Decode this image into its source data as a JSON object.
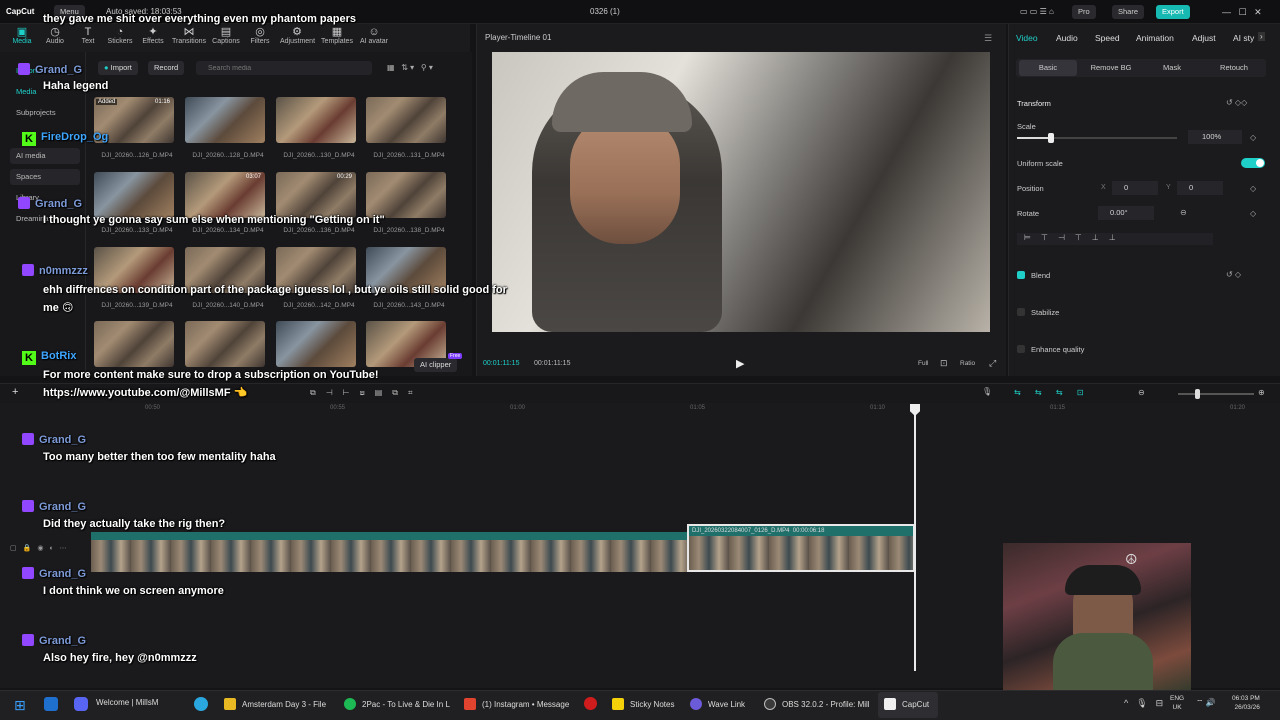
{
  "app": {
    "name": "CapCut",
    "menu": "Menu",
    "autosave": "Auto saved: 18:03:53",
    "project": "0326 (1)",
    "pro": "Pro",
    "share": "Share",
    "export": "Export"
  },
  "toolbar": [
    "Media",
    "Audio",
    "Text",
    "Stickers",
    "Effects",
    "Transitions",
    "Captions",
    "Filters",
    "Adjustment",
    "Templates",
    "AI avatar"
  ],
  "nav": [
    "Import",
    "Media",
    "Subprojects",
    "AI media",
    "Spaces",
    "Library",
    "Dreamina"
  ],
  "media_controls": {
    "import": "Import",
    "record": "Record",
    "search_placeholder": "Search media"
  },
  "thumbs": [
    {
      "label": "DJI_20260...126_D.MP4",
      "dur": "01:16",
      "added": "Added"
    },
    {
      "label": "DJI_20260...128_D.MP4",
      "dur": ""
    },
    {
      "label": "DJI_20260...130_D.MP4",
      "dur": ""
    },
    {
      "label": "DJI_20260...131_D.MP4",
      "dur": ""
    },
    {
      "label": "DJI_20260...133_D.MP4",
      "dur": ""
    },
    {
      "label": "DJI_20260...134_D.MP4",
      "dur": "03:07"
    },
    {
      "label": "DJI_20260...136_D.MP4",
      "dur": "00:29"
    },
    {
      "label": "DJI_20260...138_D.MP4",
      "dur": ""
    },
    {
      "label": "DJI_20260...139_D.MP4",
      "dur": ""
    },
    {
      "label": "DJI_20260...140_D.MP4",
      "dur": ""
    },
    {
      "label": "DJI_20260...142_D.MP4",
      "dur": ""
    },
    {
      "label": "DJI_20260...143_D.MP4",
      "dur": ""
    },
    {
      "label": "",
      "dur": ""
    },
    {
      "label": "",
      "dur": ""
    },
    {
      "label": "",
      "dur": ""
    },
    {
      "label": "",
      "dur": ""
    }
  ],
  "ai_clipper": "AI clipper",
  "free_badge": "Free",
  "player": {
    "title": "Player-Timeline 01",
    "time_current": "00:01:11:15",
    "time_total": "00:01:11:15",
    "full": "Full",
    "ratio": "Ratio"
  },
  "right_tabs": [
    "Video",
    "Audio",
    "Speed",
    "Animation",
    "Adjust",
    "AI sty"
  ],
  "right_sub": [
    "Basic",
    "Remove BG",
    "Mask",
    "Retouch"
  ],
  "props": {
    "transform": "Transform",
    "scale": "Scale",
    "scale_val": "100%",
    "uniform": "Uniform scale",
    "position": "Position",
    "x_label": "X",
    "x_val": "0",
    "y_label": "Y",
    "y_val": "0",
    "rotate": "Rotate",
    "rotate_val": "0.00°",
    "blend": "Blend",
    "stabilize": "Stabilize",
    "enhance": "Enhance quality"
  },
  "ruler": [
    "00:50",
    "00:55",
    "01:00",
    "01:05",
    "01:10",
    "01:15",
    "01:20"
  ],
  "clip": {
    "name": "DJI_20260322084007_0126_D.MP4",
    "dur": "00:00:06:18"
  },
  "chat": [
    {
      "platform": "twitch",
      "name": "",
      "msg": "they gave me shit over everything even my phantom papers"
    },
    {
      "platform": "twitch",
      "name": "Grand_G",
      "msg": "Haha legend"
    },
    {
      "platform": "kick",
      "name": "FireDrop_Og",
      "msg": ""
    },
    {
      "platform": "twitch",
      "name": "Grand_G",
      "msg": "I thought ye gonna say sum else when mentioning \"Getting on it\""
    },
    {
      "platform": "twitch",
      "name": "n0mmzzz",
      "msg": "ehh diffrences on condition part of the package iguess lol , but ye oils still solid good for me 🙃"
    },
    {
      "platform": "kick",
      "name": "BotRix",
      "msg": "For more content make sure to drop a subscription on YouTube! https://www.youtube.com/@MillsMF 👈"
    },
    {
      "platform": "twitch",
      "name": "Grand_G",
      "msg": "Too many better then too few mentality haha"
    },
    {
      "platform": "twitch",
      "name": "Grand_G",
      "msg": "Did they actually take the rig then?"
    },
    {
      "platform": "twitch",
      "name": "Grand_G",
      "msg": "I dont think we on screen anymore"
    },
    {
      "platform": "twitch",
      "name": "Grand_G",
      "msg": "Also hey fire, hey @n0mmzzz"
    }
  ],
  "taskbar": {
    "items": [
      "Welcome | MillsM",
      "Amsterdam Day 3 - File",
      "2Pac - To Live & Die In L",
      "(1) Instagram • Message",
      "Sticky Notes",
      "Wave Link",
      "OBS 32.0.2 - Profile: Mill",
      "CapCut"
    ],
    "lang": "ENG",
    "region": "UK",
    "time": "06:03 PM",
    "date": "26/03/26"
  },
  "colors": {
    "accent": "#1fd0c9",
    "export": "#17b9b3",
    "twitch": "#9146ff",
    "kick": "#53fc18"
  }
}
